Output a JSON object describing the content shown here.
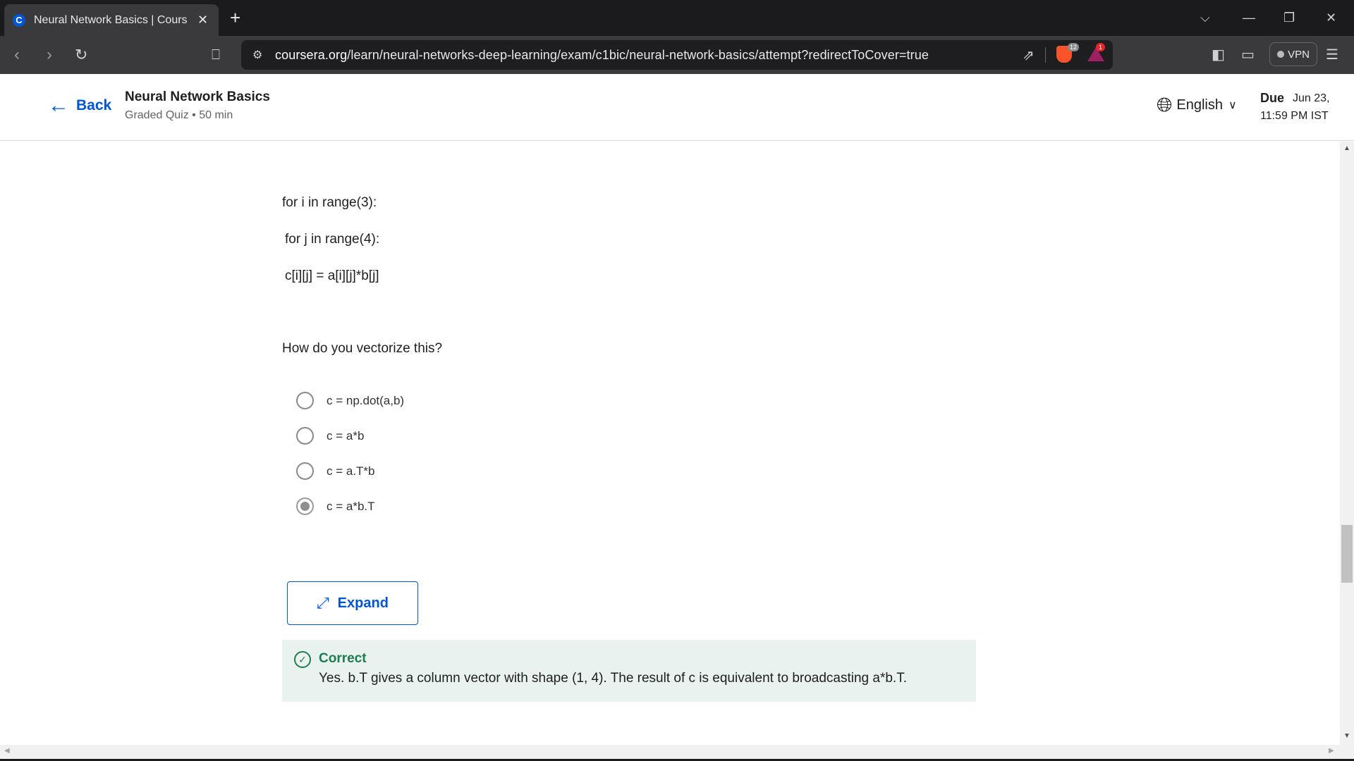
{
  "browser": {
    "tab_title": "Neural Network Basics | Coursera",
    "favicon_letter": "C",
    "new_tab": "+",
    "url_host": "coursera.org",
    "url_path": "/learn/neural-networks-deep-learning/exam/c1bic/neural-network-basics/attempt?redirectToCover=true",
    "brave_badge": "12",
    "rewards_badge": "1",
    "vpn_label": "VPN"
  },
  "header": {
    "back_label": "Back",
    "title": "Neural Network Basics",
    "meta": "Graded Quiz • 50 min",
    "language": "English",
    "due_label": "Due",
    "due_date": "Jun 23,",
    "due_time": "11:59 PM IST"
  },
  "question": {
    "code_lines": [
      "for i in range(3):",
      "for j in range(4):",
      "c[i][j] = a[i][j]*b[j]"
    ],
    "prompt": "How do you vectorize this?",
    "options": [
      {
        "label": "c = np.dot(a,b)",
        "selected": false
      },
      {
        "label": "c = a*b",
        "selected": false
      },
      {
        "label": "c = a.T*b",
        "selected": false
      },
      {
        "label": "c = a*b.T",
        "selected": true
      }
    ],
    "expand_label": "Expand"
  },
  "feedback": {
    "title": "Correct",
    "text": "Yes. b.T gives a column vector with shape (1, 4). The result of c is equivalent to broadcasting a*b.T."
  }
}
